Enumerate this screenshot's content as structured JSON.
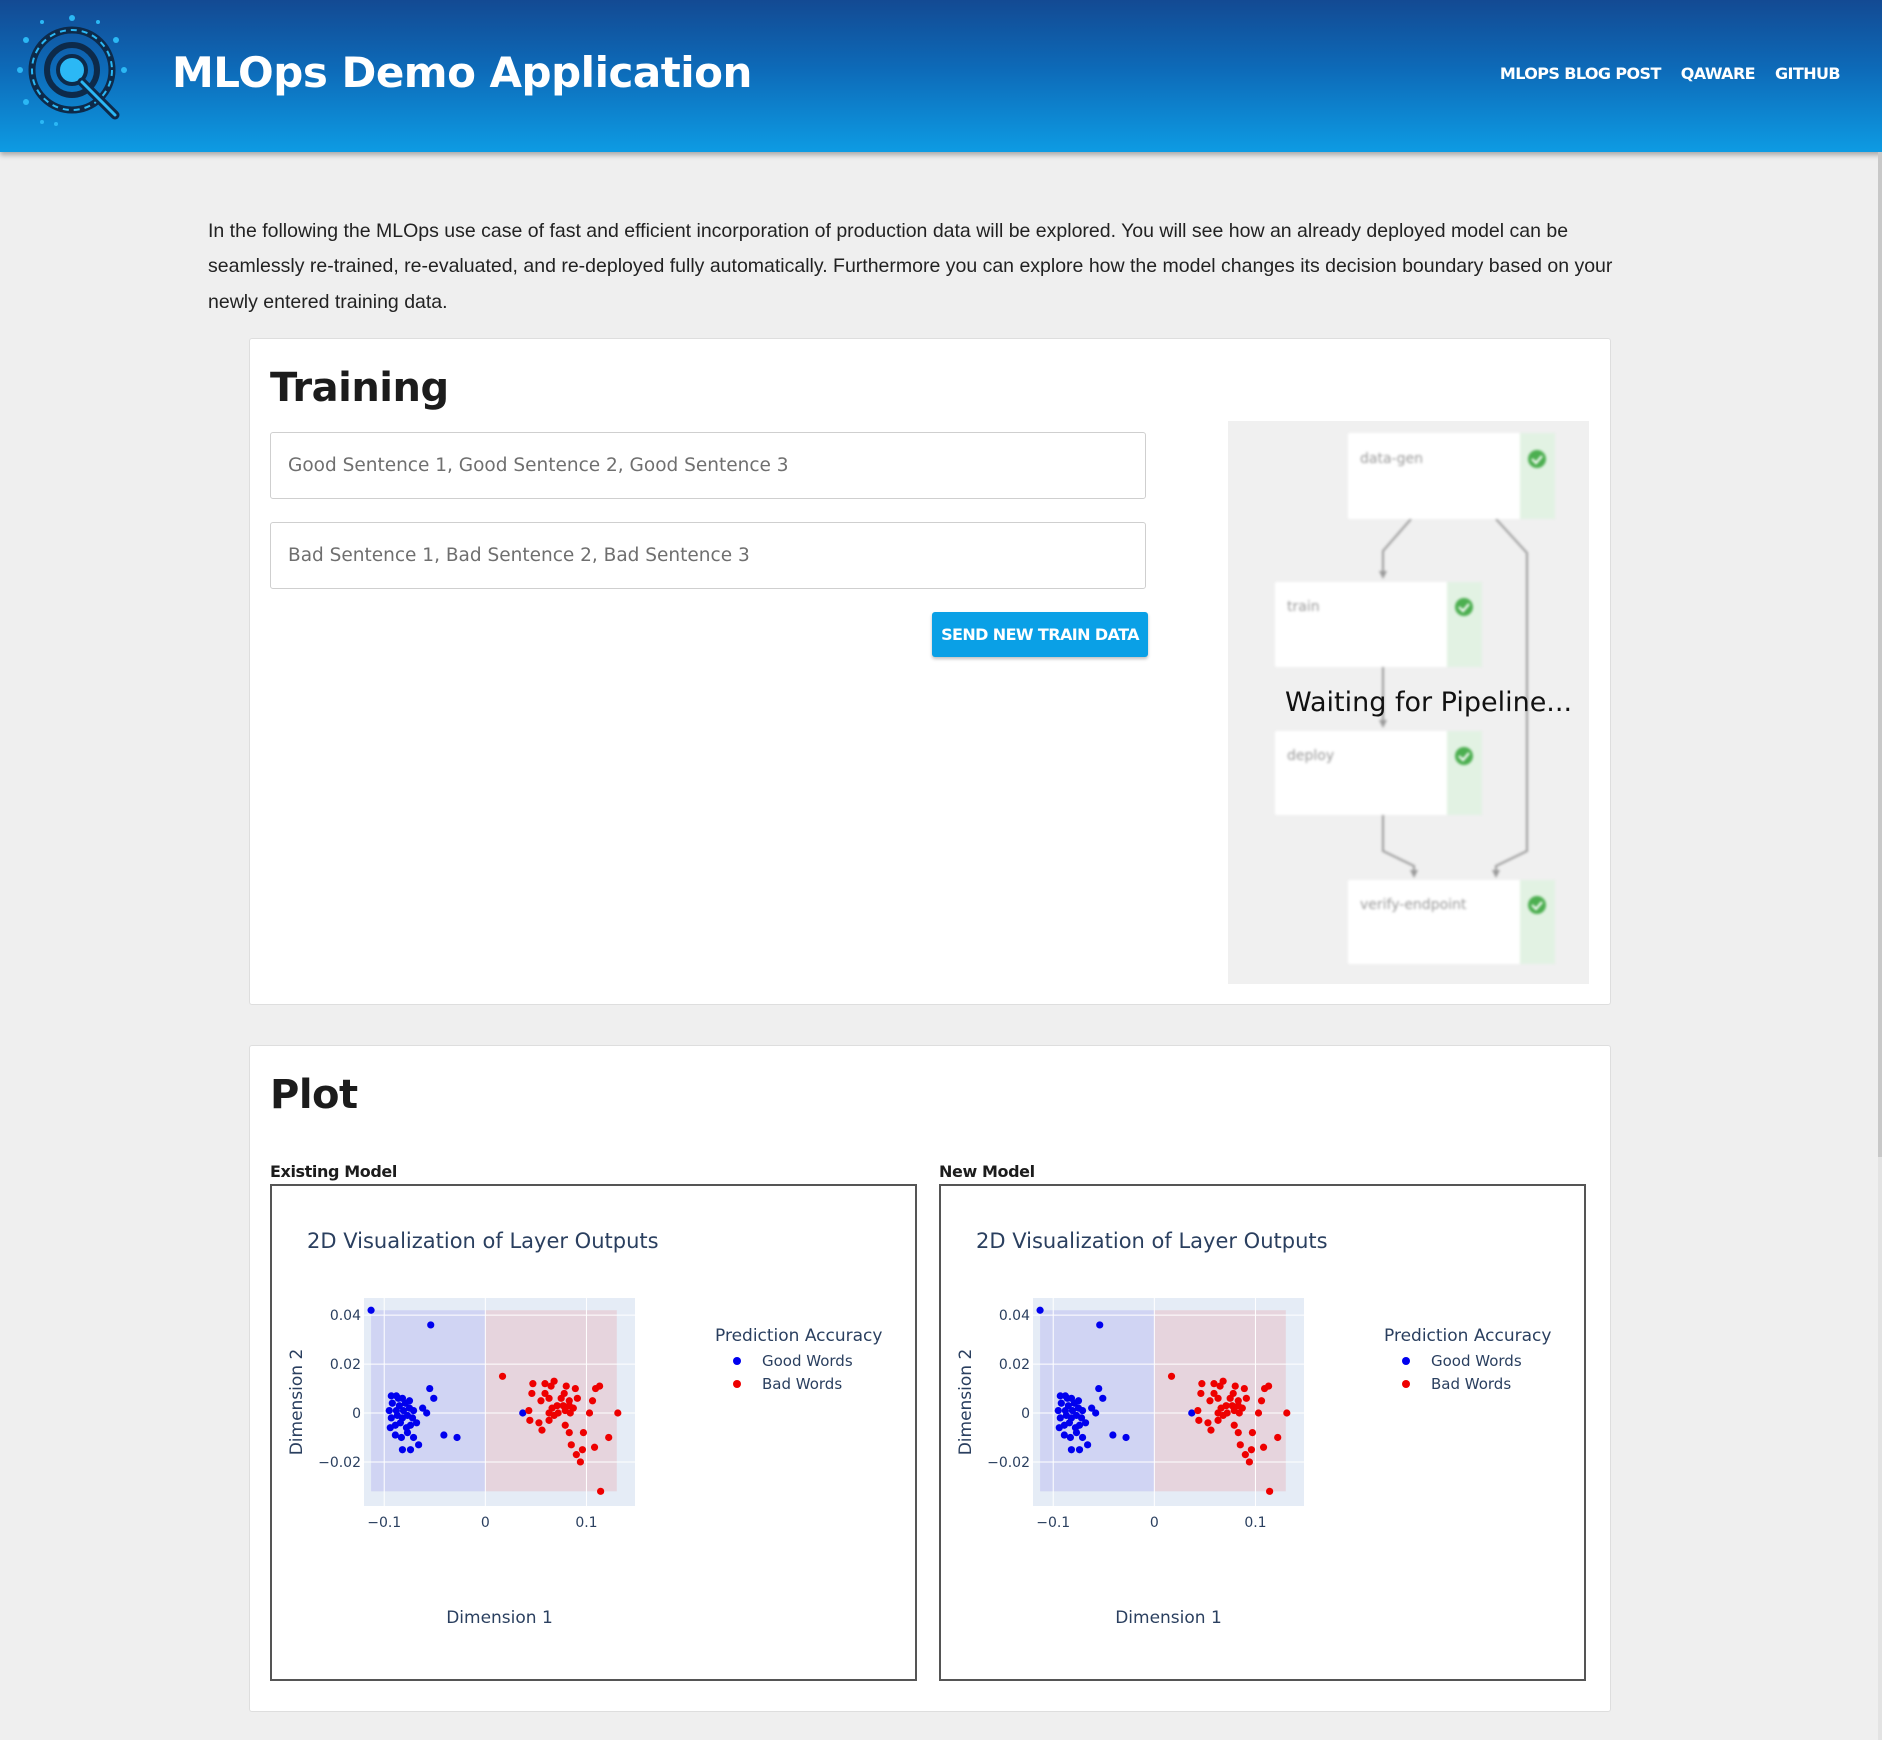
{
  "header": {
    "title": "MLOps Demo Application",
    "nav": [
      "MLOPS BLOG POST",
      "QAWARE",
      "GITHUB"
    ]
  },
  "intro": "In the following the MLOps use case of fast and efficient incorporation of production data will be explored. You will see how an already deployed model can be seamlessly re-trained, re-evaluated, and re-deployed fully automatically. Furthermore you can explore how the model changes its decision boundary based on your newly entered training data.",
  "training": {
    "title": "Training",
    "good_placeholder": "Good Sentence 1, Good Sentence 2, Good Sentence 3",
    "bad_placeholder": "Bad Sentence 1, Bad Sentence 2, Bad Sentence 3",
    "send_label": "SEND NEW TRAIN DATA",
    "pipeline": {
      "status": "Waiting for Pipeline...",
      "nodes": [
        "data-gen",
        "train",
        "deploy",
        "verify-endpoint"
      ],
      "node_state": "succeeded",
      "colors": {
        "success": "#4caf50",
        "success_bg": "#e2f2e3"
      }
    }
  },
  "plot": {
    "title": "Plot",
    "panels": [
      {
        "label": "Existing Model"
      },
      {
        "label": "New Model"
      }
    ]
  },
  "chart_data": [
    {
      "type": "scatter",
      "panel": "Existing Model",
      "title": "2D Visualization of Layer Outputs",
      "xlabel": "Dimension 1",
      "ylabel": "Dimension 2",
      "xlim": [
        -0.12,
        0.148
      ],
      "ylim": [
        -0.038,
        0.047
      ],
      "xticks": [
        {
          "v": -0.1,
          "t": "−0.1"
        },
        {
          "v": 0,
          "t": "0"
        },
        {
          "v": 0.1,
          "t": "0.1"
        }
      ],
      "yticks": [
        {
          "v": 0.04,
          "t": "0.04"
        },
        {
          "v": 0.02,
          "t": "0.02"
        },
        {
          "v": 0,
          "t": "0"
        },
        {
          "v": -0.02,
          "t": "−0.02"
        }
      ],
      "legend_title": "Prediction Accuracy",
      "legend_position": "top-right",
      "regions": [
        {
          "color": "#ccd0f2",
          "x": [
            -0.113,
            0
          ]
        },
        {
          "color": "#e6d0d8",
          "x": [
            0,
            0.13
          ]
        }
      ],
      "series": [
        {
          "name": "Good Words",
          "color": "#0000ee",
          "points": [
            [
              -0.113,
              0.042
            ],
            [
              -0.054,
              0.036
            ],
            [
              -0.055,
              0.01
            ],
            [
              -0.051,
              0.006
            ],
            [
              -0.093,
              0.007
            ],
            [
              -0.088,
              0.007
            ],
            [
              -0.086,
              0.006
            ],
            [
              -0.082,
              0.006
            ],
            [
              -0.092,
              0.004
            ],
            [
              -0.085,
              0.003
            ],
            [
              -0.079,
              0.004
            ],
            [
              -0.075,
              0.005
            ],
            [
              -0.095,
              0.001
            ],
            [
              -0.088,
              0.001
            ],
            [
              -0.081,
              0.001
            ],
            [
              -0.075,
              0.002
            ],
            [
              -0.071,
              0.001
            ],
            [
              -0.093,
              -0.002
            ],
            [
              -0.087,
              -0.001
            ],
            [
              -0.082,
              -0.002
            ],
            [
              -0.077,
              -0.001
            ],
            [
              -0.072,
              -0.002
            ],
            [
              -0.062,
              0.002
            ],
            [
              -0.058,
              0.0
            ],
            [
              -0.094,
              -0.006
            ],
            [
              -0.089,
              -0.005
            ],
            [
              -0.084,
              -0.004
            ],
            [
              -0.078,
              -0.006
            ],
            [
              -0.074,
              -0.005
            ],
            [
              -0.068,
              -0.004
            ],
            [
              -0.089,
              -0.009
            ],
            [
              -0.083,
              -0.01
            ],
            [
              -0.077,
              -0.008
            ],
            [
              -0.071,
              -0.01
            ],
            [
              -0.082,
              -0.015
            ],
            [
              -0.074,
              -0.015
            ],
            [
              -0.066,
              -0.013
            ],
            [
              -0.041,
              -0.009
            ],
            [
              -0.028,
              -0.01
            ],
            [
              0.037,
              0.0
            ]
          ]
        },
        {
          "name": "Bad Words",
          "color": "#ee0000",
          "points": [
            [
              0.017,
              0.015
            ],
            [
              0.047,
              0.012
            ],
            [
              0.059,
              0.012
            ],
            [
              0.065,
              0.011
            ],
            [
              0.068,
              0.013
            ],
            [
              0.08,
              0.011
            ],
            [
              0.089,
              0.01
            ],
            [
              0.109,
              0.01
            ],
            [
              0.113,
              0.011
            ],
            [
              0.046,
              0.008
            ],
            [
              0.059,
              0.008
            ],
            [
              0.078,
              0.008
            ],
            [
              0.055,
              0.005
            ],
            [
              0.063,
              0.006
            ],
            [
              0.075,
              0.006
            ],
            [
              0.083,
              0.005
            ],
            [
              0.091,
              0.006
            ],
            [
              0.106,
              0.005
            ],
            [
              0.083,
              0.003
            ],
            [
              0.066,
              0.002
            ],
            [
              0.071,
              0.003
            ],
            [
              0.077,
              0.003
            ],
            [
              0.087,
              0.002
            ],
            [
              0.043,
              0.001
            ],
            [
              0.063,
              0.0
            ],
            [
              0.072,
              0.0
            ],
            [
              0.079,
              0.001
            ],
            [
              0.084,
              0.0
            ],
            [
              0.068,
              -0.001
            ],
            [
              0.103,
              0.0
            ],
            [
              0.131,
              0.0
            ],
            [
              0.044,
              -0.003
            ],
            [
              0.053,
              -0.004
            ],
            [
              0.063,
              -0.003
            ],
            [
              0.079,
              -0.005
            ],
            [
              0.056,
              -0.007
            ],
            [
              0.083,
              -0.008
            ],
            [
              0.097,
              -0.008
            ],
            [
              0.122,
              -0.01
            ],
            [
              0.085,
              -0.013
            ],
            [
              0.096,
              -0.015
            ],
            [
              0.108,
              -0.014
            ],
            [
              0.09,
              -0.017
            ],
            [
              0.094,
              -0.02
            ],
            [
              0.114,
              -0.032
            ]
          ]
        }
      ]
    },
    {
      "type": "scatter",
      "panel": "New Model",
      "title": "2D Visualization of Layer Outputs",
      "xlabel": "Dimension 1",
      "ylabel": "Dimension 2",
      "xlim": [
        -0.12,
        0.148
      ],
      "ylim": [
        -0.038,
        0.047
      ],
      "xticks": [
        {
          "v": -0.1,
          "t": "−0.1"
        },
        {
          "v": 0,
          "t": "0"
        },
        {
          "v": 0.1,
          "t": "0.1"
        }
      ],
      "yticks": [
        {
          "v": 0.04,
          "t": "0.04"
        },
        {
          "v": 0.02,
          "t": "0.02"
        },
        {
          "v": 0,
          "t": "0"
        },
        {
          "v": -0.02,
          "t": "−0.02"
        }
      ],
      "legend_title": "Prediction Accuracy",
      "legend_position": "top-right",
      "regions": [
        {
          "color": "#ccd0f2",
          "x": [
            -0.113,
            0
          ]
        },
        {
          "color": "#e6d0d8",
          "x": [
            0,
            0.13
          ]
        }
      ],
      "series": [
        {
          "name": "Good Words",
          "color": "#0000ee",
          "points": [
            [
              -0.113,
              0.042
            ],
            [
              -0.054,
              0.036
            ],
            [
              -0.055,
              0.01
            ],
            [
              -0.051,
              0.006
            ],
            [
              -0.093,
              0.007
            ],
            [
              -0.088,
              0.007
            ],
            [
              -0.086,
              0.006
            ],
            [
              -0.082,
              0.006
            ],
            [
              -0.092,
              0.004
            ],
            [
              -0.085,
              0.003
            ],
            [
              -0.079,
              0.004
            ],
            [
              -0.075,
              0.005
            ],
            [
              -0.095,
              0.001
            ],
            [
              -0.088,
              0.001
            ],
            [
              -0.081,
              0.001
            ],
            [
              -0.075,
              0.002
            ],
            [
              -0.071,
              0.001
            ],
            [
              -0.093,
              -0.002
            ],
            [
              -0.087,
              -0.001
            ],
            [
              -0.082,
              -0.002
            ],
            [
              -0.077,
              -0.001
            ],
            [
              -0.072,
              -0.002
            ],
            [
              -0.062,
              0.002
            ],
            [
              -0.058,
              0.0
            ],
            [
              -0.094,
              -0.006
            ],
            [
              -0.089,
              -0.005
            ],
            [
              -0.084,
              -0.004
            ],
            [
              -0.078,
              -0.006
            ],
            [
              -0.074,
              -0.005
            ],
            [
              -0.068,
              -0.004
            ],
            [
              -0.089,
              -0.009
            ],
            [
              -0.083,
              -0.01
            ],
            [
              -0.077,
              -0.008
            ],
            [
              -0.071,
              -0.01
            ],
            [
              -0.082,
              -0.015
            ],
            [
              -0.074,
              -0.015
            ],
            [
              -0.066,
              -0.013
            ],
            [
              -0.041,
              -0.009
            ],
            [
              -0.028,
              -0.01
            ],
            [
              0.037,
              0.0
            ]
          ]
        },
        {
          "name": "Bad Words",
          "color": "#ee0000",
          "points": [
            [
              0.017,
              0.015
            ],
            [
              0.047,
              0.012
            ],
            [
              0.059,
              0.012
            ],
            [
              0.065,
              0.011
            ],
            [
              0.068,
              0.013
            ],
            [
              0.08,
              0.011
            ],
            [
              0.089,
              0.01
            ],
            [
              0.109,
              0.01
            ],
            [
              0.113,
              0.011
            ],
            [
              0.046,
              0.008
            ],
            [
              0.059,
              0.008
            ],
            [
              0.078,
              0.008
            ],
            [
              0.055,
              0.005
            ],
            [
              0.063,
              0.006
            ],
            [
              0.075,
              0.006
            ],
            [
              0.083,
              0.005
            ],
            [
              0.091,
              0.006
            ],
            [
              0.106,
              0.005
            ],
            [
              0.083,
              0.003
            ],
            [
              0.066,
              0.002
            ],
            [
              0.071,
              0.003
            ],
            [
              0.077,
              0.003
            ],
            [
              0.087,
              0.002
            ],
            [
              0.043,
              0.001
            ],
            [
              0.063,
              0.0
            ],
            [
              0.072,
              0.0
            ],
            [
              0.079,
              0.001
            ],
            [
              0.084,
              0.0
            ],
            [
              0.068,
              -0.001
            ],
            [
              0.103,
              0.0
            ],
            [
              0.131,
              0.0
            ],
            [
              0.044,
              -0.003
            ],
            [
              0.053,
              -0.004
            ],
            [
              0.063,
              -0.003
            ],
            [
              0.079,
              -0.005
            ],
            [
              0.056,
              -0.007
            ],
            [
              0.083,
              -0.008
            ],
            [
              0.097,
              -0.008
            ],
            [
              0.122,
              -0.01
            ],
            [
              0.085,
              -0.013
            ],
            [
              0.096,
              -0.015
            ],
            [
              0.108,
              -0.014
            ],
            [
              0.09,
              -0.017
            ],
            [
              0.094,
              -0.02
            ],
            [
              0.114,
              -0.032
            ]
          ]
        }
      ]
    }
  ]
}
